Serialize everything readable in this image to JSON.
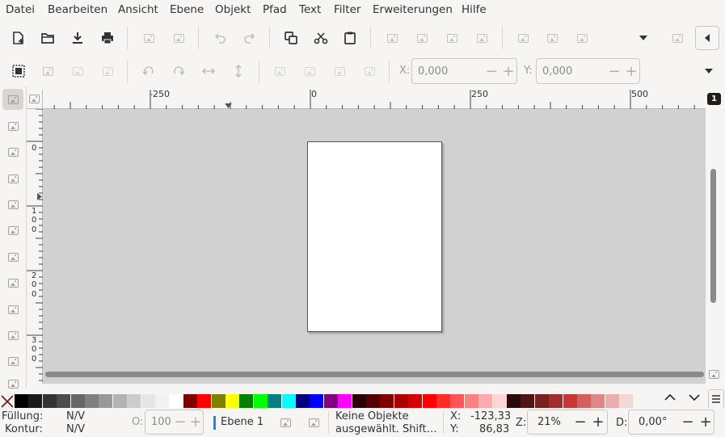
{
  "menu": [
    "Datei",
    "Bearbeiten",
    "Ansicht",
    "Ebene",
    "Objekt",
    "Pfad",
    "Text",
    "Filter",
    "Erweiterungen",
    "Hilfe"
  ],
  "toolbar2": {
    "x_label": "X:",
    "x_value": "0,000",
    "y_label": "Y:",
    "y_value": "0,000"
  },
  "ruler_top_labels": [
    "-250",
    "0",
    "250",
    "500"
  ],
  "ruler_left_labels": [
    [
      "0"
    ],
    [
      "1",
      "0",
      "0"
    ],
    [
      "2",
      "0",
      "0"
    ],
    [
      "3",
      "0",
      "0"
    ]
  ],
  "canvas_badge": "1",
  "palette": {
    "colors": [
      "#000000",
      "#1a1a1a",
      "#333333",
      "#4d4d4d",
      "#666666",
      "#808080",
      "#999999",
      "#b3b3b3",
      "#cccccc",
      "#e6e6e6",
      "#f2f2f2",
      "#ffffff",
      "#800000",
      "#ff0000",
      "#808000",
      "#ffff00",
      "#008000",
      "#00ff00",
      "#008080",
      "#00ffff",
      "#000080",
      "#0000ff",
      "#800080",
      "#ff00ff",
      "#2b0000",
      "#550000",
      "#800000",
      "#aa0000",
      "#d40000",
      "#ff0000",
      "#ff2a2a",
      "#ff5555",
      "#ff8080",
      "#ffaaaa",
      "#ffd5d5",
      "#280b0b",
      "#501616",
      "#782121",
      "#a02c2c",
      "#c83737",
      "#d35f5f",
      "#de8787",
      "#e9afaf",
      "#f4d7d7"
    ]
  },
  "status": {
    "fill_label": "Füllung:",
    "fill_value": "N/V",
    "stroke_label": "Kontur:",
    "stroke_value": "N/V",
    "opacity_label": "O:",
    "opacity_value": "100",
    "layer_name": "Ebene 1",
    "message_line1": "Keine Objekte",
    "message_line2": "ausgewählt. Shift…",
    "cursor_x_label": "X:",
    "cursor_x": "-123,33",
    "cursor_y_label": "Y:",
    "cursor_y": "86,83",
    "zoom_label": "Z:",
    "zoom_value": "21%",
    "rotation_label": "D:",
    "rotation_value": "0,00°"
  }
}
